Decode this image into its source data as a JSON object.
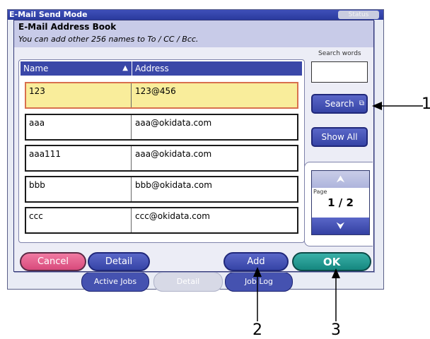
{
  "window": {
    "title": "E-Mail Send Mode",
    "status_label": "Status"
  },
  "background_tabs": [
    "Active Jobs",
    "Detail",
    "Job Log"
  ],
  "dialog": {
    "title": "E-Mail Address Book",
    "subtitle": "You can add other 256 names to To / CC / Bcc."
  },
  "table": {
    "columns": {
      "name": "Name",
      "sort_glyph": "▲",
      "address": "Address"
    },
    "rows": [
      {
        "name": "123",
        "address": "123@456",
        "selected": true
      },
      {
        "name": "aaa",
        "address": "aaa@okidata.com",
        "selected": false
      },
      {
        "name": "aaa111",
        "address": "aaa@okidata.com",
        "selected": false
      },
      {
        "name": "bbb",
        "address": "bbb@okidata.com",
        "selected": false
      },
      {
        "name": "ccc",
        "address": "ccc@okidata.com",
        "selected": false
      }
    ]
  },
  "search": {
    "label": "Search words",
    "value": "",
    "search_button": "Search",
    "show_all_button": "Show All"
  },
  "pager": {
    "label": "Page",
    "value": "1 / 2"
  },
  "buttons": {
    "cancel": "Cancel",
    "detail": "Detail",
    "add": "Add",
    "ok": "OK"
  },
  "callouts": {
    "c1": "1",
    "c2": "2",
    "c3": "3"
  },
  "colors": {
    "selected_row": "#f9ed9b",
    "ok_button": "#15877f",
    "cancel_button": "#d84a7c",
    "accent_blue": "#3644a6"
  }
}
